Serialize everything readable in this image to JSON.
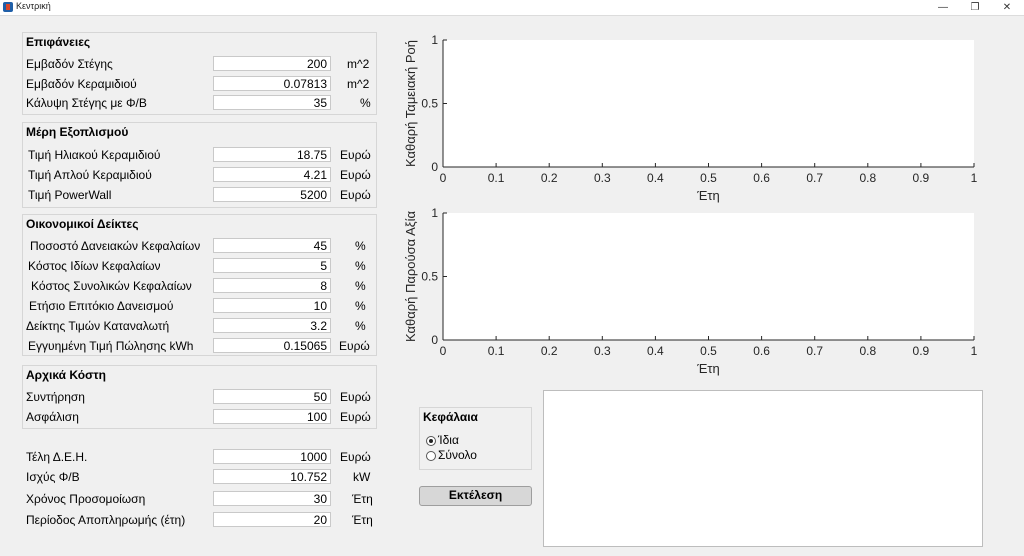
{
  "window": {
    "title": "Κεντρική",
    "minimize": "—",
    "restore": "❐",
    "close": "✕"
  },
  "surfaces": {
    "title": "Επιφάνειες",
    "rows": [
      {
        "label": "Εμβαδόν Στέγης",
        "value": "200",
        "unit": "m^2"
      },
      {
        "label": "Εμβαδόν Κεραμιδιού",
        "value": "0.07813",
        "unit": "m^2"
      },
      {
        "label": "Κάλυψη Στέγης με Φ/Β",
        "value": "35",
        "unit": "%"
      }
    ]
  },
  "equipment": {
    "title": "Μέρη Εξοπλισμού",
    "rows": [
      {
        "label": "Τιμή Ηλιακού Κεραμιδιού",
        "value": "18.75",
        "unit": "Ευρώ"
      },
      {
        "label": "Τιμή Απλού Κεραμιδιού",
        "value": "4.21",
        "unit": "Ευρώ"
      },
      {
        "label": "Τιμή PowerWall",
        "value": "5200",
        "unit": "Ευρώ"
      }
    ]
  },
  "economic": {
    "title": "Οικονομικοί Δείκτες",
    "rows": [
      {
        "label": "Ποσοστό Δανειακών Κεφαλαίων",
        "value": "45",
        "unit": "%"
      },
      {
        "label": "Κόστος Ιδίων Κεφαλαίων",
        "value": "5",
        "unit": "%"
      },
      {
        "label": "Κόστος Συνολικών Κεφαλαίων",
        "value": "8",
        "unit": "%"
      },
      {
        "label": "Ετήσιο Επιτόκιο Δανεισμού",
        "value": "10",
        "unit": "%"
      },
      {
        "label": "Δείκτης Τιμών Καταναλωτή",
        "value": "3.2",
        "unit": "%"
      },
      {
        "label": "Εγγυημένη Τιμή Πώλησης kWh",
        "value": "0.15065",
        "unit": "Ευρώ"
      }
    ]
  },
  "initial_costs": {
    "title": "Αρχικά Κόστη",
    "rows": [
      {
        "label": "Συντήρηση",
        "value": "50",
        "unit": "Ευρώ"
      },
      {
        "label": "Ασφάλιση",
        "value": "100",
        "unit": "Ευρώ"
      }
    ]
  },
  "bottom": {
    "rows": [
      {
        "label": "Τέλη Δ.Ε.Η.",
        "value": "1000",
        "unit": "Ευρώ"
      },
      {
        "label": "Ισχύς Φ/Β",
        "value": "10.752",
        "unit": "kW"
      },
      {
        "label": "Χρόνος Προσομοίωση",
        "value": "30",
        "unit": "Έτη"
      },
      {
        "label": "Περίοδος Αποπληρωμής (έτη)",
        "value": "20",
        "unit": "Έτη"
      }
    ]
  },
  "capital": {
    "title": "Κεφάλαια",
    "options": [
      "Ίδια",
      "Σύνολο"
    ],
    "selected": "Ίδια"
  },
  "run_button": "Εκτέλεση",
  "chart_data": [
    {
      "type": "line",
      "ylabel": "Καθαρή Ταμειακή Ροή",
      "xlabel": "Έτη",
      "xlim": [
        0,
        1
      ],
      "ylim": [
        0,
        1
      ],
      "xticks": [
        "0",
        "0.1",
        "0.2",
        "0.3",
        "0.4",
        "0.5",
        "0.6",
        "0.7",
        "0.8",
        "0.9",
        "1"
      ],
      "yticks": [
        "0",
        "0.5",
        "1"
      ],
      "series": []
    },
    {
      "type": "line",
      "ylabel": "Καθαρή Παρούσα Αξία",
      "xlabel": "Έτη",
      "xlim": [
        0,
        1
      ],
      "ylim": [
        0,
        1
      ],
      "xticks": [
        "0",
        "0.1",
        "0.2",
        "0.3",
        "0.4",
        "0.5",
        "0.6",
        "0.7",
        "0.8",
        "0.9",
        "1"
      ],
      "yticks": [
        "0",
        "0.5",
        "1"
      ],
      "series": []
    }
  ]
}
